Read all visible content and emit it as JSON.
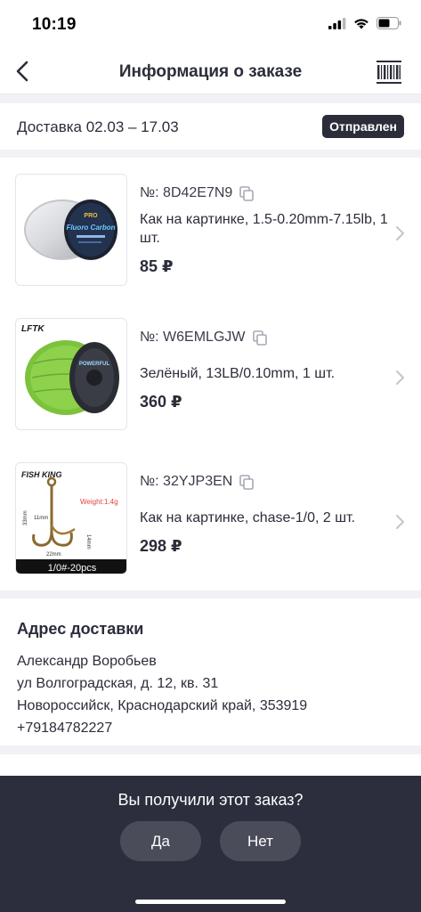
{
  "status_bar": {
    "time": "10:19"
  },
  "nav": {
    "title": "Информация о заказе"
  },
  "delivery": {
    "text": "Доставка 02.03 – 17.03",
    "status": "Отправлен"
  },
  "items": [
    {
      "number": "№: 8D42E7N9",
      "description": "Как на картинке, 1.5-0.20mm-7.15lb, 1 шт.",
      "price": "85 ₽",
      "thumb_brand": "PRO",
      "thumb_text": "Fluoro Carbon"
    },
    {
      "number": "№: W6EMLGJW",
      "description": "Зелёный, 13LB/0.10mm, 1 шт.",
      "price": "360 ₽",
      "thumb_brand": "LFTK",
      "thumb_text": "POWERFUL"
    },
    {
      "number": "№: 32YJP3EN",
      "description": "Как на картинке, chase-1/0, 2 шт.",
      "price": "298 ₽",
      "thumb_brand": "FISH KING",
      "thumb_weight": "Weight:1.4g",
      "thumb_dim1": "11mm",
      "thumb_dim2": "33mm",
      "thumb_dim3": "14mm",
      "thumb_dim4": "22mm",
      "thumb_caption": "1/0#-20pcs"
    }
  ],
  "address": {
    "title": "Адрес доставки",
    "name": "Александр Воробьев",
    "street": "ул Волгоградская, д. 12, кв. 31",
    "city": "Новороссийск, Краснодарский край, 353919",
    "phone": "+79184782227"
  },
  "confirm": {
    "question": "Вы получили этот заказ?",
    "yes": "Да",
    "no": "Нет"
  },
  "colors": {
    "dark": "#2c2e3d",
    "badge": "#2b2d3a",
    "button": "#4a4c5a",
    "background": "#f1f2f5"
  }
}
